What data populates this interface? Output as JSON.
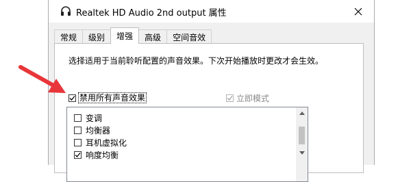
{
  "window": {
    "title": "Realtek HD Audio 2nd output 属性",
    "close_icon": "close-icon",
    "app_icon": "headphones-icon"
  },
  "tabs": [
    {
      "label": "常规",
      "active": false
    },
    {
      "label": "级别",
      "active": false
    },
    {
      "label": "增强",
      "active": true
    },
    {
      "label": "高级",
      "active": false
    },
    {
      "label": "空间音效",
      "active": false
    }
  ],
  "panel": {
    "description": "选择适用于当前聆听配置的声音效果。下次开始播放时更改才会生效。",
    "disable_all": {
      "label": "禁用所有声音效果",
      "checked": true
    },
    "immediate_mode": {
      "label": "立即模式",
      "checked": true,
      "disabled": true
    },
    "effects": [
      {
        "label": "变调",
        "checked": false
      },
      {
        "label": "均衡器",
        "checked": false
      },
      {
        "label": "耳机虚拟化",
        "checked": false
      },
      {
        "label": "响度均衡",
        "checked": true
      }
    ]
  },
  "annotation": {
    "arrow_color": "#e8363a"
  }
}
